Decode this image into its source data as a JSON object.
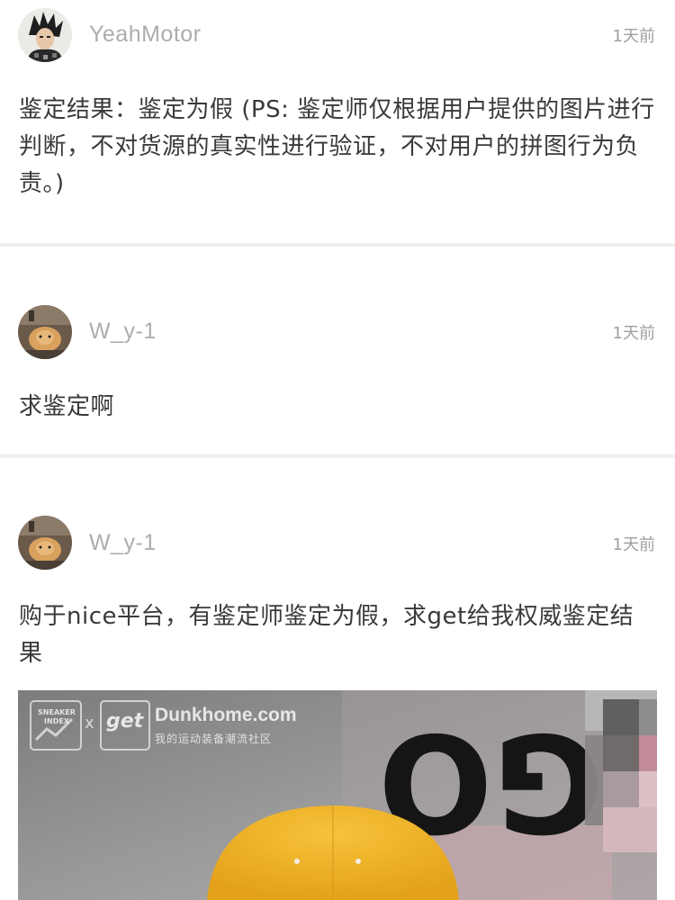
{
  "posts": [
    {
      "username": "YeahMotor",
      "time": "1天前",
      "content": "鉴定结果：鉴定为假 (PS: 鉴定师仅根据用户提供的图片进行判断，不对货源的真实性进行验证，不对用户的拼图行为负责。)"
    },
    {
      "username": "W_y-1",
      "time": "1天前",
      "content": "求鉴定啊"
    },
    {
      "username": "W_y-1",
      "time": "1天前",
      "content": "购于nice平台，有鉴定师鉴定为假，求get给我权威鉴定结果"
    }
  ],
  "watermark": {
    "sneaker_index_line1": "SNEAKER",
    "sneaker_index_line2": "INDEX",
    "x": "x",
    "get": "get",
    "site": "Dunkhome.com",
    "slogan": "我的运动装备潮流社区"
  },
  "photo_print": "GO"
}
